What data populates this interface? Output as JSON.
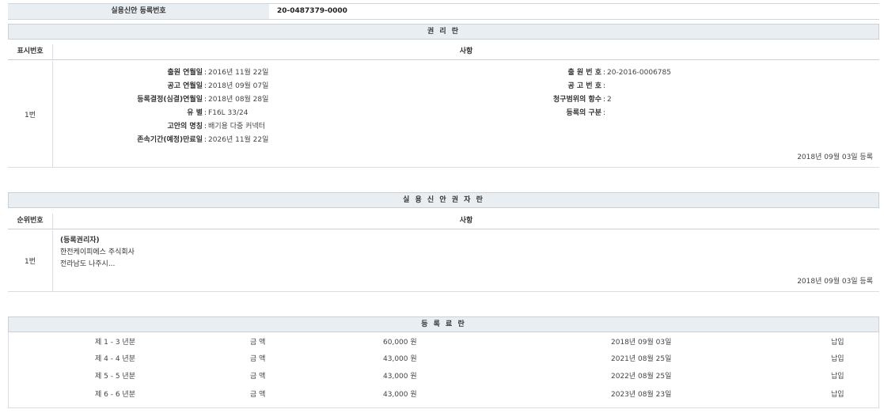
{
  "registration": {
    "label": "실용신안 등록번호",
    "number": "20-0487379-0000"
  },
  "rights_section": {
    "title": "권 리 란",
    "col_number": "표시번호",
    "col_details": "사항",
    "entry_number": "1번",
    "left_fields": [
      {
        "key": "출원 연월일",
        "value": "2016년 11월 22일"
      },
      {
        "key": "공고 연월일",
        "value": "2018년 09월 07일"
      },
      {
        "key": "등록결정(심결)연월일",
        "value": "2018년 08월 28일"
      },
      {
        "key": "유 별",
        "value": "F16L 33/24"
      },
      {
        "key": "고안의 명칭",
        "value": "배기용 다중 커넥터"
      },
      {
        "key": "존속기간(예정)만료일",
        "value": "2026년 11월 22일"
      }
    ],
    "right_fields": [
      {
        "key": "출 원 번 호",
        "value": "20-2016-0006785"
      },
      {
        "key": "공 고 번 호",
        "value": ""
      },
      {
        "key": "청구범위의 항수",
        "value": "2"
      },
      {
        "key": "등록의 구분",
        "value": ""
      }
    ],
    "registered_date": "2018년 09월 03일 등록"
  },
  "holder_section": {
    "title": "실 용 신 안 권 자 란",
    "col_rank": "순위번호",
    "col_details": "사항",
    "entry_number": "1번",
    "holder_type": "(등록권리자)",
    "holder_name": "한전케이피에스 주식회사",
    "holder_address": "전라남도 나주시...",
    "registered_date": "2018년 09월 03일 등록"
  },
  "fee_section": {
    "title": "등 록 료 란",
    "rows": [
      {
        "period": "제 1 - 3 년분",
        "amount_label": "금 액",
        "amount": "60,000 원",
        "date": "2018년 09월 03일",
        "status": "납입"
      },
      {
        "period": "제 4 - 4 년분",
        "amount_label": "금 액",
        "amount": "43,000 원",
        "date": "2021년 08월 25일",
        "status": "납입"
      },
      {
        "period": "제 5 - 5 년분",
        "amount_label": "금 액",
        "amount": "43,000 원",
        "date": "2022년 08월 25일",
        "status": "납입"
      },
      {
        "period": "제 6 - 6 년분",
        "amount_label": "금 액",
        "amount": "43,000 원",
        "date": "2023년 08월 23일",
        "status": "납입"
      }
    ]
  }
}
